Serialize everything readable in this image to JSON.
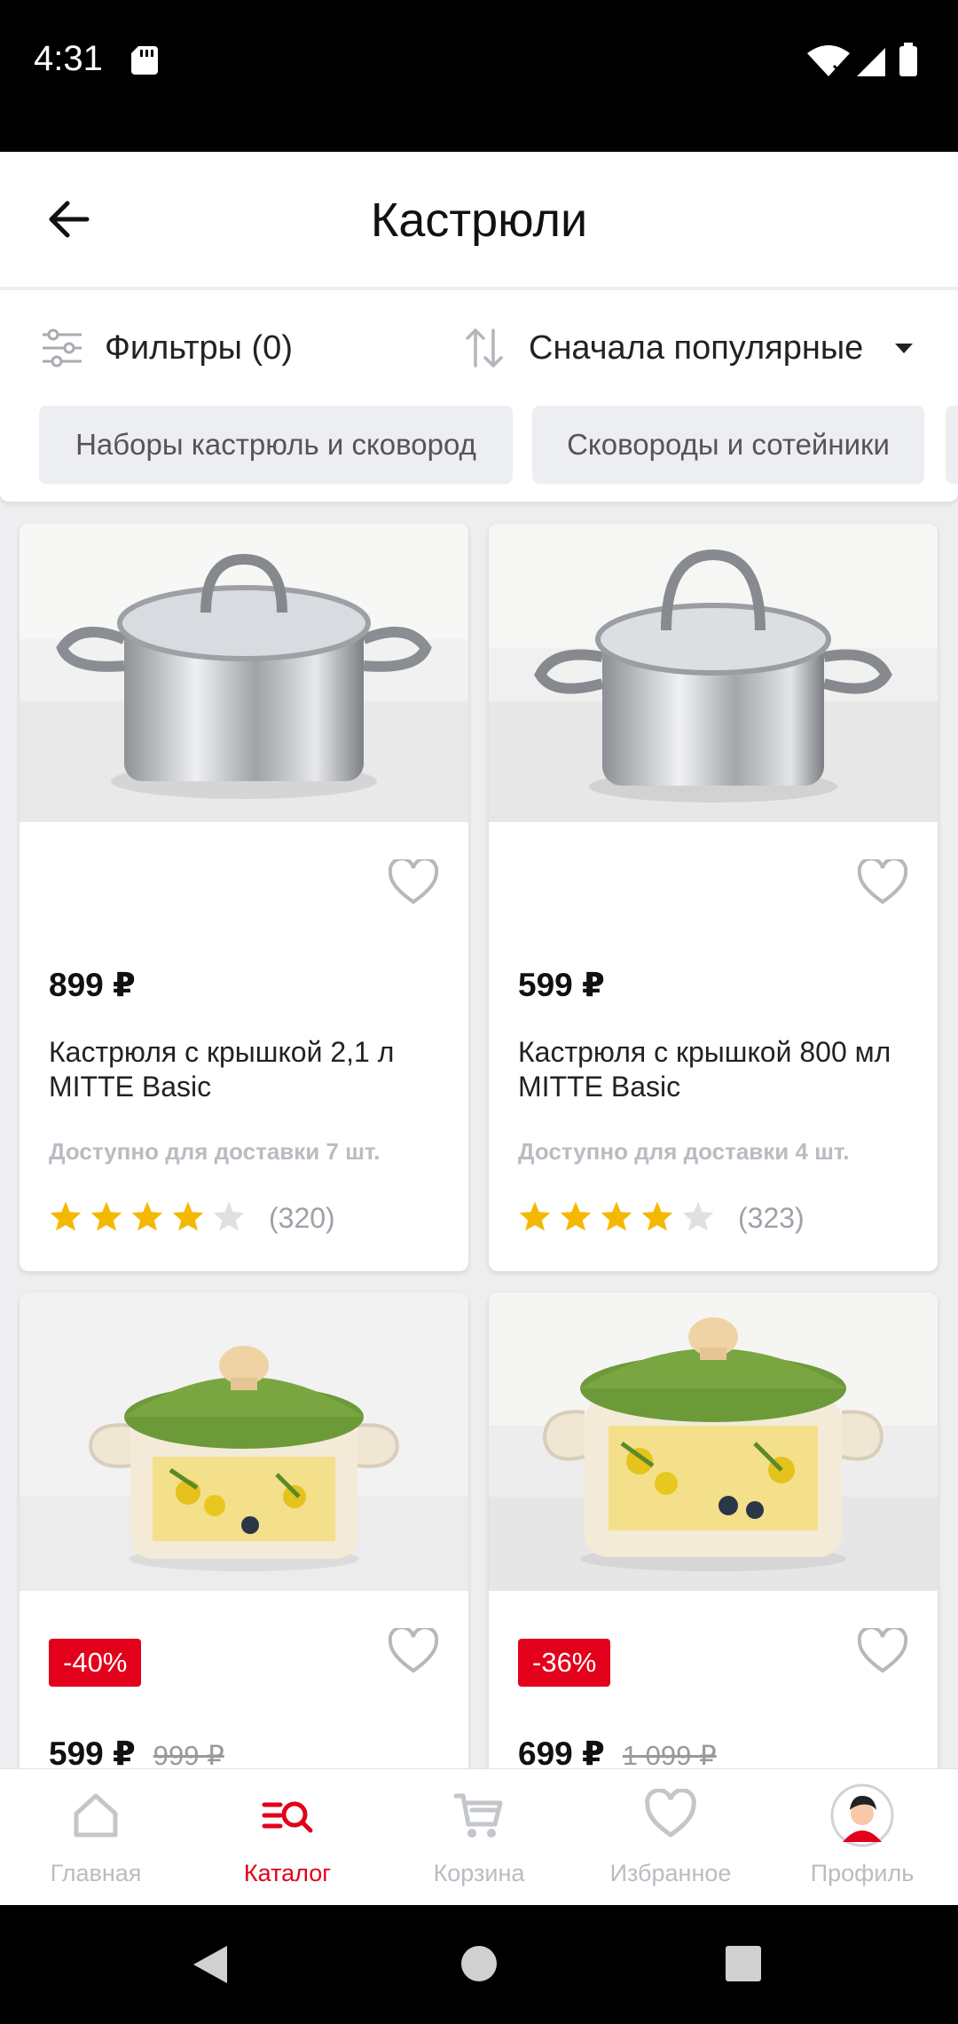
{
  "status_bar": {
    "time": "4:31"
  },
  "header": {
    "title": "Кастрюли"
  },
  "toolbar": {
    "filters_label": "Фильтры (0)",
    "sort_label": "Сначала популярные"
  },
  "chips": [
    {
      "label": "Наборы кастрюль и сковород"
    },
    {
      "label": "Сковороды и сотейники"
    }
  ],
  "products": [
    {
      "price": "899 ₽",
      "old_price": "",
      "discount": "",
      "name": "Кастрюля с крышкой 2,1 л MITTE Basic",
      "stock": "Доступно для доставки 7 шт.",
      "rating": 4,
      "reviews": "(320)"
    },
    {
      "price": "599 ₽",
      "old_price": "",
      "discount": "",
      "name": "Кастрюля с крышкой 800 мл MITTE Basic",
      "stock": "Доступно для доставки 4 шт.",
      "rating": 4,
      "reviews": "(323)"
    },
    {
      "price": "599 ₽",
      "old_price": "999 ₽",
      "discount": "-40%",
      "name": "",
      "stock": "",
      "rating": null,
      "reviews": ""
    },
    {
      "price": "699 ₽",
      "old_price": "1 099 ₽",
      "discount": "-36%",
      "name": "",
      "stock": "",
      "rating": null,
      "reviews": ""
    }
  ],
  "bottom_nav": [
    {
      "label": "Главная",
      "icon": "home-icon",
      "active": false
    },
    {
      "label": "Каталог",
      "icon": "catalog-search-icon",
      "active": true
    },
    {
      "label": "Корзина",
      "icon": "cart-icon",
      "active": false
    },
    {
      "label": "Избранное",
      "icon": "heart-icon",
      "active": false
    },
    {
      "label": "Профиль",
      "icon": "avatar-icon",
      "active": false
    }
  ],
  "colors": {
    "accent": "#e3001b",
    "star": "#f5b800",
    "star_empty": "#e0e0e0"
  }
}
